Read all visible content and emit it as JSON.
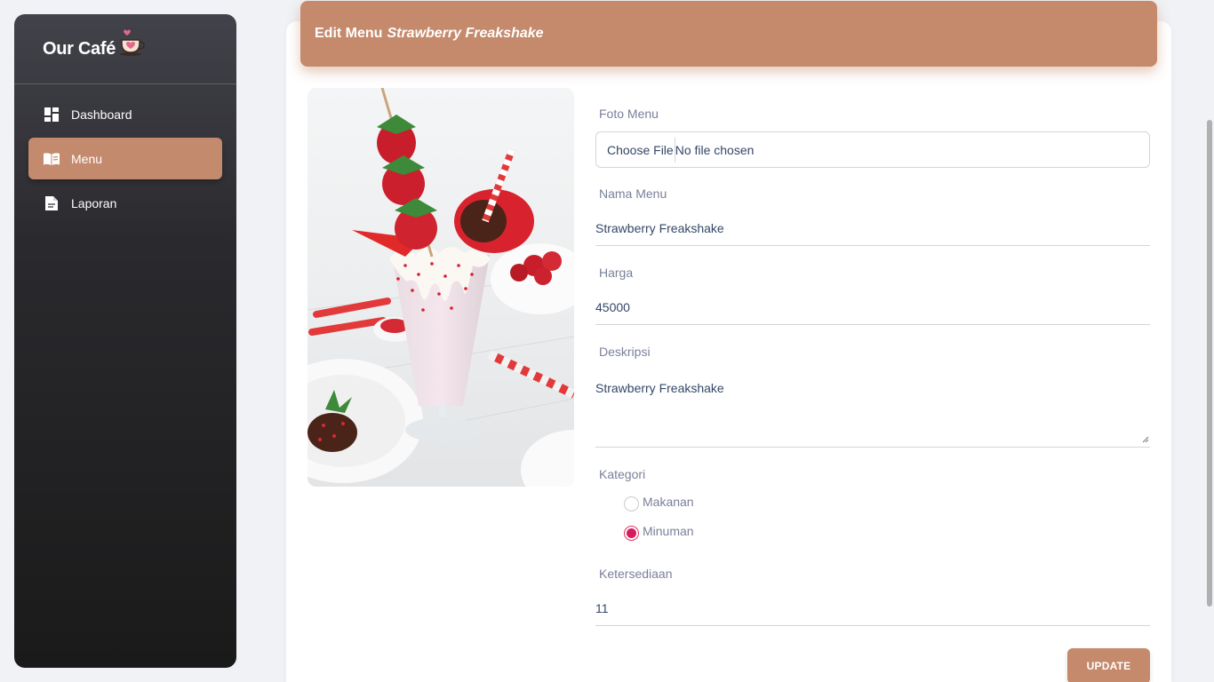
{
  "brand": {
    "title": "Our Café"
  },
  "sidebar": {
    "items": [
      {
        "label": "Dashboard",
        "icon": "dashboard-icon",
        "active": false
      },
      {
        "label": "Menu",
        "icon": "menu-book-icon",
        "active": true
      },
      {
        "label": "Laporan",
        "icon": "report-icon",
        "active": false
      }
    ]
  },
  "header": {
    "prefix": "Edit Menu",
    "menu_name": "Strawberry Freakshake"
  },
  "form": {
    "photo_label": "Foto Menu",
    "file_button": "Choose File",
    "file_status": "No file chosen",
    "name_label": "Nama Menu",
    "name_value": "Strawberry Freakshake",
    "price_label": "Harga",
    "price_value": "45000",
    "desc_label": "Deskripsi",
    "desc_value": "Strawberry Freakshake",
    "category_label": "Kategori",
    "category_options": [
      {
        "label": "Makanan",
        "checked": false
      },
      {
        "label": "Minuman",
        "checked": true
      }
    ],
    "stock_label": "Ketersediaan",
    "stock_value": "11",
    "submit_label": "UPDATE"
  },
  "colors": {
    "accent": "#c5896b",
    "radio_checked": "#d81b60",
    "sidebar_dark": "#1a1a1a"
  }
}
